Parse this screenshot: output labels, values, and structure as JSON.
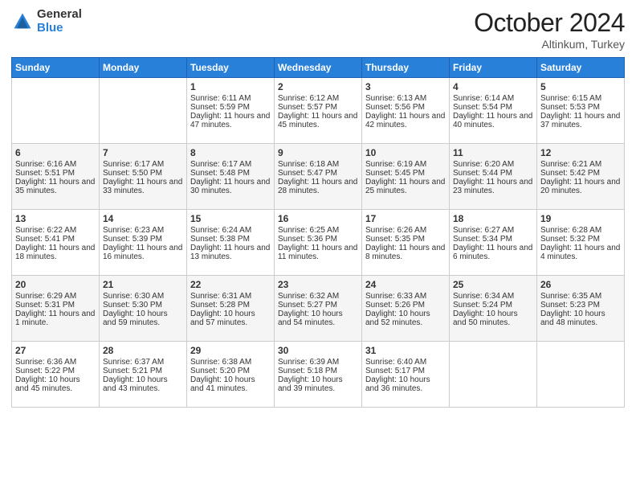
{
  "logo": {
    "general": "General",
    "blue": "Blue"
  },
  "header": {
    "month": "October 2024",
    "location": "Altinkum, Turkey"
  },
  "weekdays": [
    "Sunday",
    "Monday",
    "Tuesday",
    "Wednesday",
    "Thursday",
    "Friday",
    "Saturday"
  ],
  "weeks": [
    [
      {
        "day": "",
        "sunrise": "",
        "sunset": "",
        "daylight": ""
      },
      {
        "day": "",
        "sunrise": "",
        "sunset": "",
        "daylight": ""
      },
      {
        "day": "1",
        "sunrise": "Sunrise: 6:11 AM",
        "sunset": "Sunset: 5:59 PM",
        "daylight": "Daylight: 11 hours and 47 minutes."
      },
      {
        "day": "2",
        "sunrise": "Sunrise: 6:12 AM",
        "sunset": "Sunset: 5:57 PM",
        "daylight": "Daylight: 11 hours and 45 minutes."
      },
      {
        "day": "3",
        "sunrise": "Sunrise: 6:13 AM",
        "sunset": "Sunset: 5:56 PM",
        "daylight": "Daylight: 11 hours and 42 minutes."
      },
      {
        "day": "4",
        "sunrise": "Sunrise: 6:14 AM",
        "sunset": "Sunset: 5:54 PM",
        "daylight": "Daylight: 11 hours and 40 minutes."
      },
      {
        "day": "5",
        "sunrise": "Sunrise: 6:15 AM",
        "sunset": "Sunset: 5:53 PM",
        "daylight": "Daylight: 11 hours and 37 minutes."
      }
    ],
    [
      {
        "day": "6",
        "sunrise": "Sunrise: 6:16 AM",
        "sunset": "Sunset: 5:51 PM",
        "daylight": "Daylight: 11 hours and 35 minutes."
      },
      {
        "day": "7",
        "sunrise": "Sunrise: 6:17 AM",
        "sunset": "Sunset: 5:50 PM",
        "daylight": "Daylight: 11 hours and 33 minutes."
      },
      {
        "day": "8",
        "sunrise": "Sunrise: 6:17 AM",
        "sunset": "Sunset: 5:48 PM",
        "daylight": "Daylight: 11 hours and 30 minutes."
      },
      {
        "day": "9",
        "sunrise": "Sunrise: 6:18 AM",
        "sunset": "Sunset: 5:47 PM",
        "daylight": "Daylight: 11 hours and 28 minutes."
      },
      {
        "day": "10",
        "sunrise": "Sunrise: 6:19 AM",
        "sunset": "Sunset: 5:45 PM",
        "daylight": "Daylight: 11 hours and 25 minutes."
      },
      {
        "day": "11",
        "sunrise": "Sunrise: 6:20 AM",
        "sunset": "Sunset: 5:44 PM",
        "daylight": "Daylight: 11 hours and 23 minutes."
      },
      {
        "day": "12",
        "sunrise": "Sunrise: 6:21 AM",
        "sunset": "Sunset: 5:42 PM",
        "daylight": "Daylight: 11 hours and 20 minutes."
      }
    ],
    [
      {
        "day": "13",
        "sunrise": "Sunrise: 6:22 AM",
        "sunset": "Sunset: 5:41 PM",
        "daylight": "Daylight: 11 hours and 18 minutes."
      },
      {
        "day": "14",
        "sunrise": "Sunrise: 6:23 AM",
        "sunset": "Sunset: 5:39 PM",
        "daylight": "Daylight: 11 hours and 16 minutes."
      },
      {
        "day": "15",
        "sunrise": "Sunrise: 6:24 AM",
        "sunset": "Sunset: 5:38 PM",
        "daylight": "Daylight: 11 hours and 13 minutes."
      },
      {
        "day": "16",
        "sunrise": "Sunrise: 6:25 AM",
        "sunset": "Sunset: 5:36 PM",
        "daylight": "Daylight: 11 hours and 11 minutes."
      },
      {
        "day": "17",
        "sunrise": "Sunrise: 6:26 AM",
        "sunset": "Sunset: 5:35 PM",
        "daylight": "Daylight: 11 hours and 8 minutes."
      },
      {
        "day": "18",
        "sunrise": "Sunrise: 6:27 AM",
        "sunset": "Sunset: 5:34 PM",
        "daylight": "Daylight: 11 hours and 6 minutes."
      },
      {
        "day": "19",
        "sunrise": "Sunrise: 6:28 AM",
        "sunset": "Sunset: 5:32 PM",
        "daylight": "Daylight: 11 hours and 4 minutes."
      }
    ],
    [
      {
        "day": "20",
        "sunrise": "Sunrise: 6:29 AM",
        "sunset": "Sunset: 5:31 PM",
        "daylight": "Daylight: 11 hours and 1 minute."
      },
      {
        "day": "21",
        "sunrise": "Sunrise: 6:30 AM",
        "sunset": "Sunset: 5:30 PM",
        "daylight": "Daylight: 10 hours and 59 minutes."
      },
      {
        "day": "22",
        "sunrise": "Sunrise: 6:31 AM",
        "sunset": "Sunset: 5:28 PM",
        "daylight": "Daylight: 10 hours and 57 minutes."
      },
      {
        "day": "23",
        "sunrise": "Sunrise: 6:32 AM",
        "sunset": "Sunset: 5:27 PM",
        "daylight": "Daylight: 10 hours and 54 minutes."
      },
      {
        "day": "24",
        "sunrise": "Sunrise: 6:33 AM",
        "sunset": "Sunset: 5:26 PM",
        "daylight": "Daylight: 10 hours and 52 minutes."
      },
      {
        "day": "25",
        "sunrise": "Sunrise: 6:34 AM",
        "sunset": "Sunset: 5:24 PM",
        "daylight": "Daylight: 10 hours and 50 minutes."
      },
      {
        "day": "26",
        "sunrise": "Sunrise: 6:35 AM",
        "sunset": "Sunset: 5:23 PM",
        "daylight": "Daylight: 10 hours and 48 minutes."
      }
    ],
    [
      {
        "day": "27",
        "sunrise": "Sunrise: 6:36 AM",
        "sunset": "Sunset: 5:22 PM",
        "daylight": "Daylight: 10 hours and 45 minutes."
      },
      {
        "day": "28",
        "sunrise": "Sunrise: 6:37 AM",
        "sunset": "Sunset: 5:21 PM",
        "daylight": "Daylight: 10 hours and 43 minutes."
      },
      {
        "day": "29",
        "sunrise": "Sunrise: 6:38 AM",
        "sunset": "Sunset: 5:20 PM",
        "daylight": "Daylight: 10 hours and 41 minutes."
      },
      {
        "day": "30",
        "sunrise": "Sunrise: 6:39 AM",
        "sunset": "Sunset: 5:18 PM",
        "daylight": "Daylight: 10 hours and 39 minutes."
      },
      {
        "day": "31",
        "sunrise": "Sunrise: 6:40 AM",
        "sunset": "Sunset: 5:17 PM",
        "daylight": "Daylight: 10 hours and 36 minutes."
      },
      {
        "day": "",
        "sunrise": "",
        "sunset": "",
        "daylight": ""
      },
      {
        "day": "",
        "sunrise": "",
        "sunset": "",
        "daylight": ""
      }
    ]
  ]
}
